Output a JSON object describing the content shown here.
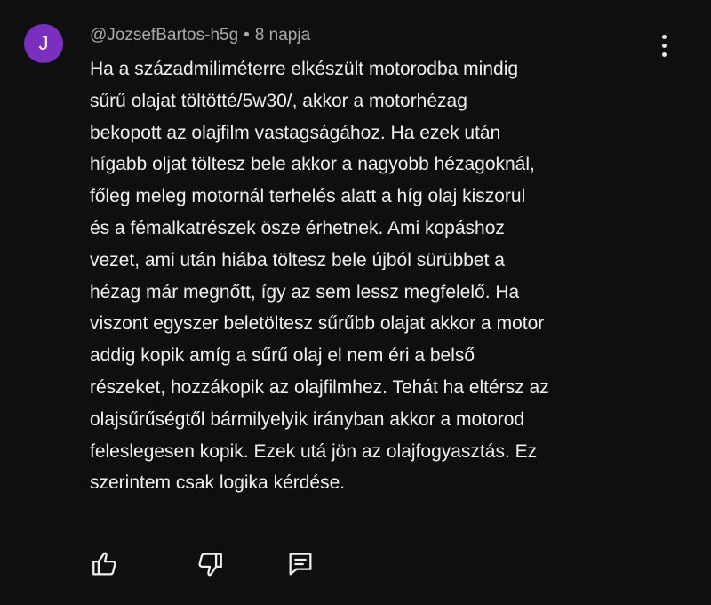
{
  "comment": {
    "avatar_letter": "J",
    "avatar_color": "#7b2fbe",
    "author": "@JozsefBartos-h5g",
    "separator": "•",
    "time": "8 napja",
    "text": "Ha a századmiliméterre elkészült motorodba mindig\nsűrű olajat töltötté/5w30/, akkor a motorhézag\nbekopott az olajfilm vastagságához. Ha ezek után\nhígabb oljat töltesz bele akkor a nagyobb hézagoknál,\nfőleg meleg motornál terhelés alatt a híg olaj kiszorul\nés a fémalkatrészek ösze érhetnek. Ami kopáshoz\nvezet, ami után hiába töltesz bele újból sürübbet a\nhézag már megnőtt, így az sem lessz megfelelő. Ha\nviszont egyszer beletöltesz sűrűbb olajat akkor a motor\naddig kopik amíg a sűrű olaj el nem éri a belső\nrészeket, hozzákopik az olajfilmhez. Tehát ha eltérsz az\nolajsűrűségtől bármilyelyik irányban akkor a motorod\nfeleslegesen kopik. Ezek utá jön az olajfogyasztás. Ez\nszerintem csak logika kérdése."
  },
  "icons": {
    "like": "thumbs-up-icon",
    "dislike": "thumbs-down-icon",
    "reply": "comment-icon",
    "menu": "more-vertical-icon"
  }
}
